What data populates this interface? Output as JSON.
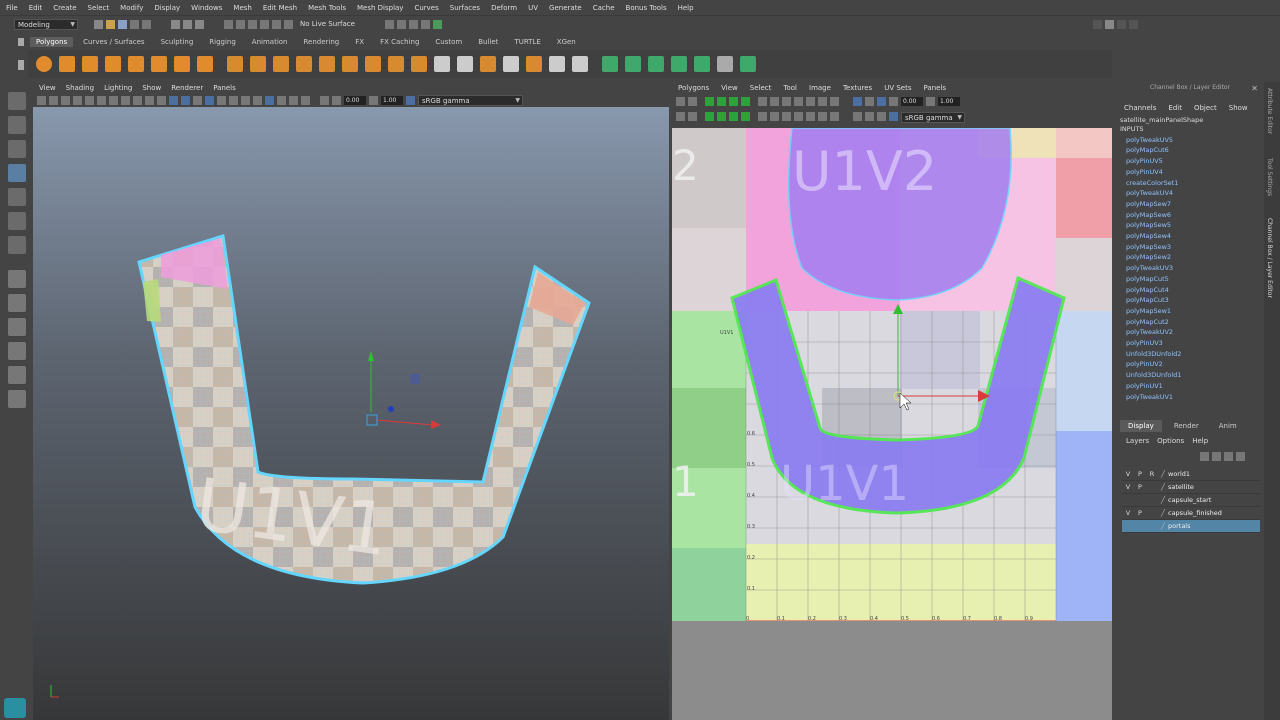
{
  "menubar": [
    "File",
    "Edit",
    "Create",
    "Select",
    "Modify",
    "Display",
    "Windows",
    "Mesh",
    "Edit Mesh",
    "Mesh Tools",
    "Mesh Display",
    "Curves",
    "Surfaces",
    "Deform",
    "UV",
    "Generate",
    "Cache",
    "Bonus Tools",
    "Help"
  ],
  "status": {
    "mode": "Modeling",
    "live_surface": "No Live Surface"
  },
  "shelf_tabs": [
    "Polygons",
    "Curves / Surfaces",
    "Sculpting",
    "Rigging",
    "Animation",
    "Rendering",
    "FX",
    "FX Caching",
    "Custom",
    "Bullet",
    "TURTLE",
    "XGen"
  ],
  "shelf_active": "Polygons",
  "viewport": {
    "menu": [
      "View",
      "Shading",
      "Lighting",
      "Show",
      "Renderer",
      "Panels"
    ],
    "field_a": "0.00",
    "field_b": "1.00",
    "colorspace": "sRGB gamma",
    "mesh_text": "U1V1"
  },
  "uv_editor": {
    "menu": [
      "Polygons",
      "View",
      "Select",
      "Tool",
      "Image",
      "Textures",
      "UV Sets",
      "Panels"
    ],
    "field_a": "0.00",
    "field_b": "1.00",
    "colorspace": "sRGB gamma",
    "tile_text_top": "U1V2",
    "tile_text_main": "U1V1",
    "left_numbers": [
      "2",
      "1"
    ],
    "axis_x": [
      "0",
      "0.1",
      "0.2",
      "0.3",
      "0.4",
      "0.5",
      "0.6",
      "0.7",
      "0.8",
      "0.9"
    ],
    "axis_y": [
      "0.1",
      "0.2",
      "0.3",
      "0.4",
      "0.5",
      "0.6"
    ],
    "mini_label": "U1V1"
  },
  "channel_box": {
    "title": "Channel Box / Layer Editor",
    "menu": [
      "Channels",
      "Edit",
      "Object",
      "Show"
    ],
    "object": "satellite_mainPanelShape",
    "inputs_label": "INPUTS",
    "inputs": [
      "polyTweakUV5",
      "polyMapCut6",
      "polyPinUV5",
      "polyPinUV4",
      "createColorSet1",
      "polyTweakUV4",
      "polyMapSew7",
      "polyMapSew6",
      "polyMapSew5",
      "polyMapSew4",
      "polyMapSew3",
      "polyMapSew2",
      "polyTweakUV3",
      "polyMapCut5",
      "polyMapCut4",
      "polyMapCut3",
      "polyMapSew1",
      "polyMapCut2",
      "polyTweakUV2",
      "polyPinUV3",
      "Unfold3DUnfold2",
      "polyPinUV2",
      "Unfold3DUnfold1",
      "polyPinUV1",
      "polyTweakUV1"
    ]
  },
  "layer_editor": {
    "tabs": [
      "Display",
      "Render",
      "Anim"
    ],
    "active_tab": "Display",
    "menu": [
      "Layers",
      "Options",
      "Help"
    ],
    "layers": [
      {
        "v": "V",
        "p": "P",
        "r": "R",
        "name": "world1"
      },
      {
        "v": "V",
        "p": "P",
        "r": "",
        "name": "satellite"
      },
      {
        "v": "",
        "p": "",
        "r": "",
        "name": "capsule_start"
      },
      {
        "v": "V",
        "p": "P",
        "r": "",
        "name": "capsule_finished"
      },
      {
        "v": "",
        "p": "",
        "r": "",
        "name": "portals"
      }
    ],
    "selected_layer": "portals"
  },
  "side_tabs": [
    "Attribute Editor",
    "Tool Settings",
    "Channel Box / Layer Editor"
  ],
  "colors": {
    "uv_outline": "#4ee84e",
    "mesh_outline": "#63d6ff",
    "selected_row": "#5285a6"
  }
}
